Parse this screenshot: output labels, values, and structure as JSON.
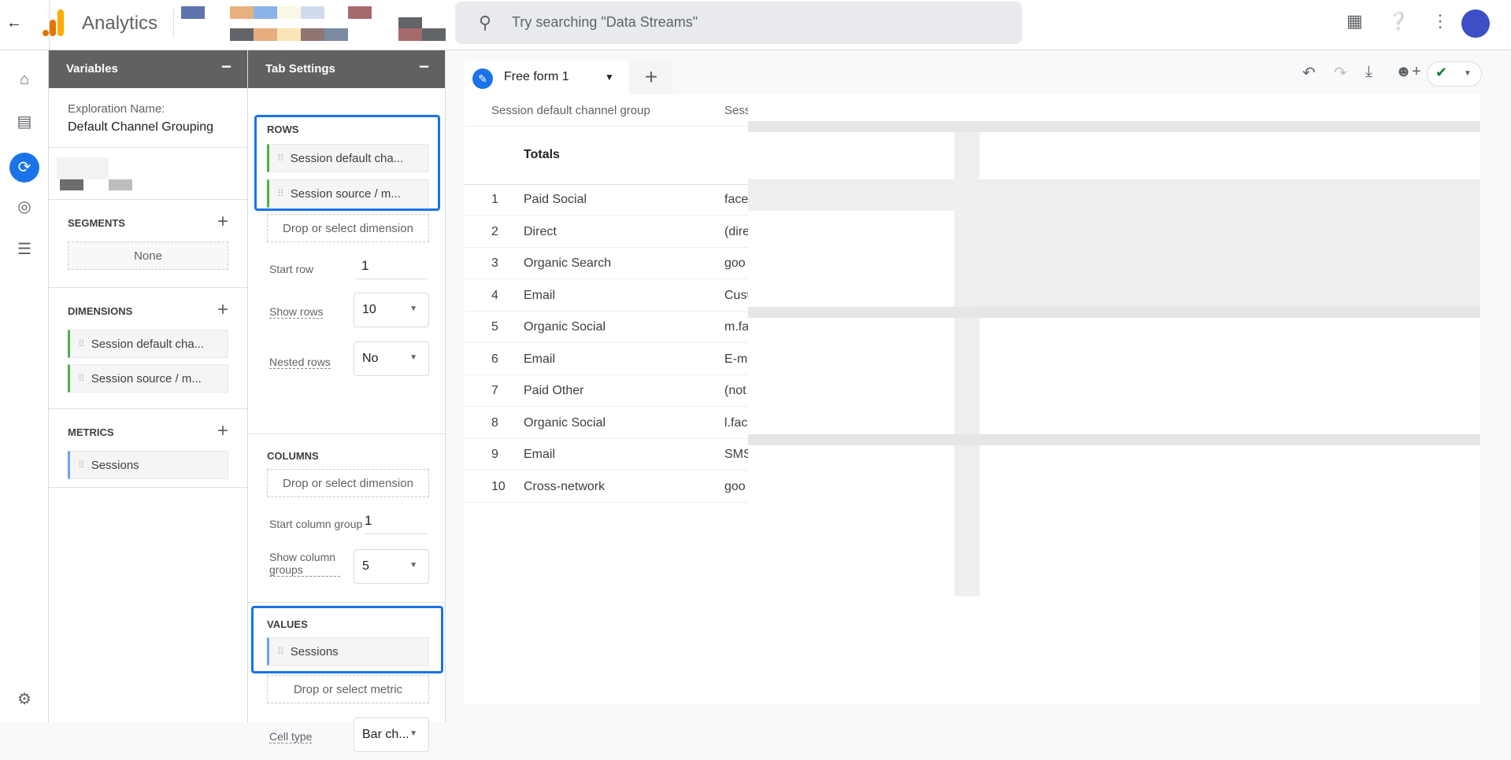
{
  "app": {
    "title": "Analytics",
    "search_placeholder": "Try searching \"Data Streams\""
  },
  "variables": {
    "header": "Variables",
    "exploration_label": "Exploration Name:",
    "exploration_name": "Default Channel Grouping",
    "segments_label": "SEGMENTS",
    "segments_value": "None",
    "dimensions_label": "DIMENSIONS",
    "dimensions": [
      "Session default cha...",
      "Session source / m..."
    ],
    "metrics_label": "METRICS",
    "metrics": [
      "Sessions"
    ]
  },
  "tab_settings": {
    "header": "Tab Settings",
    "rows_label": "ROWS",
    "rows": [
      "Session default cha...",
      "Session source / m..."
    ],
    "drop_dimension": "Drop or select dimension",
    "start_row_label": "Start row",
    "start_row": "1",
    "show_rows_label": "Show rows",
    "show_rows": "10",
    "nested_rows_label": "Nested rows",
    "nested_rows": "No",
    "columns_label": "COLUMNS",
    "start_column_group_label": "Start column group",
    "start_column_group": "1",
    "show_column_groups_label": "Show column groups",
    "show_column_groups": "5",
    "values_label": "VALUES",
    "values": [
      "Sessions"
    ],
    "drop_metric": "Drop or select metric",
    "cell_type_label": "Cell type",
    "cell_type": "Bar ch..."
  },
  "tab": {
    "label": "Free form 1"
  },
  "table": {
    "headers": [
      "Session default channel group",
      "Sess"
    ],
    "totals_label": "Totals",
    "rows": [
      {
        "n": "1",
        "channel": "Paid Social",
        "source": "face"
      },
      {
        "n": "2",
        "channel": "Direct",
        "source": "(dire"
      },
      {
        "n": "3",
        "channel": "Organic Search",
        "source": "goo"
      },
      {
        "n": "4",
        "channel": "Email",
        "source": "Cust"
      },
      {
        "n": "5",
        "channel": "Organic Social",
        "source": "m.fa"
      },
      {
        "n": "6",
        "channel": "Email",
        "source": "E-m"
      },
      {
        "n": "7",
        "channel": "Paid Other",
        "source": "(not"
      },
      {
        "n": "8",
        "channel": "Organic Social",
        "source": "l.fac"
      },
      {
        "n": "9",
        "channel": "Email",
        "source": "SMS"
      },
      {
        "n": "10",
        "channel": "Cross-network",
        "source": "goo"
      }
    ]
  },
  "colors": {
    "accent": "#1a73e8",
    "panel_header": "#616161",
    "dimension_chip": "#4caf50",
    "metric_chip": "#6fa1f3"
  }
}
